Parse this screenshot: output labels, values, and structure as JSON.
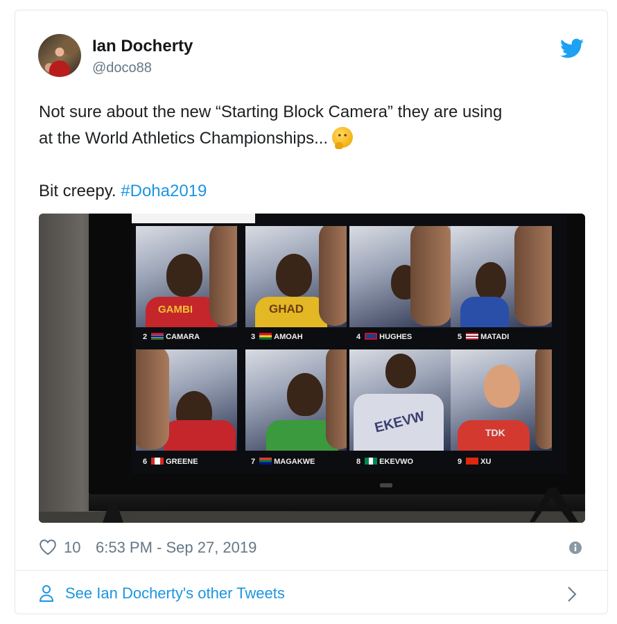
{
  "tweet": {
    "author_name": "Ian Docherty",
    "author_handle": "@doco88",
    "text_line1": "Not sure about the new “Starting Block Camera” they are using",
    "text_line2": "at the World Athletics Championships...",
    "text_line3_prefix": "Bit creepy.",
    "hashtag": "#Doha2019",
    "emoji_icon": "thinking-face-icon",
    "brand_icon": "twitter-bird-icon",
    "brand_color": "#1b95e0"
  },
  "media": {
    "lanes": [
      {
        "num": "2",
        "name": "CAMARA",
        "shirt_text": "GAMBI"
      },
      {
        "num": "3",
        "name": "AMOAH",
        "shirt_text": "GHAD"
      },
      {
        "num": "4",
        "name": "HUGHES",
        "shirt_text": ""
      },
      {
        "num": "5",
        "name": "MATADI",
        "shirt_text": ""
      },
      {
        "num": "6",
        "name": "GREENE",
        "shirt_text": ""
      },
      {
        "num": "7",
        "name": "MAGAKWE",
        "shirt_text": ""
      },
      {
        "num": "8",
        "name": "EKEVWO",
        "shirt_text": "EKEVW"
      },
      {
        "num": "9",
        "name": "XU",
        "shirt_text": "TDK"
      }
    ]
  },
  "footer": {
    "like_count": "10",
    "timestamp": "6:53 PM - Sep 27, 2019",
    "more_tweets_label": "See Ian Docherty's other Tweets"
  }
}
